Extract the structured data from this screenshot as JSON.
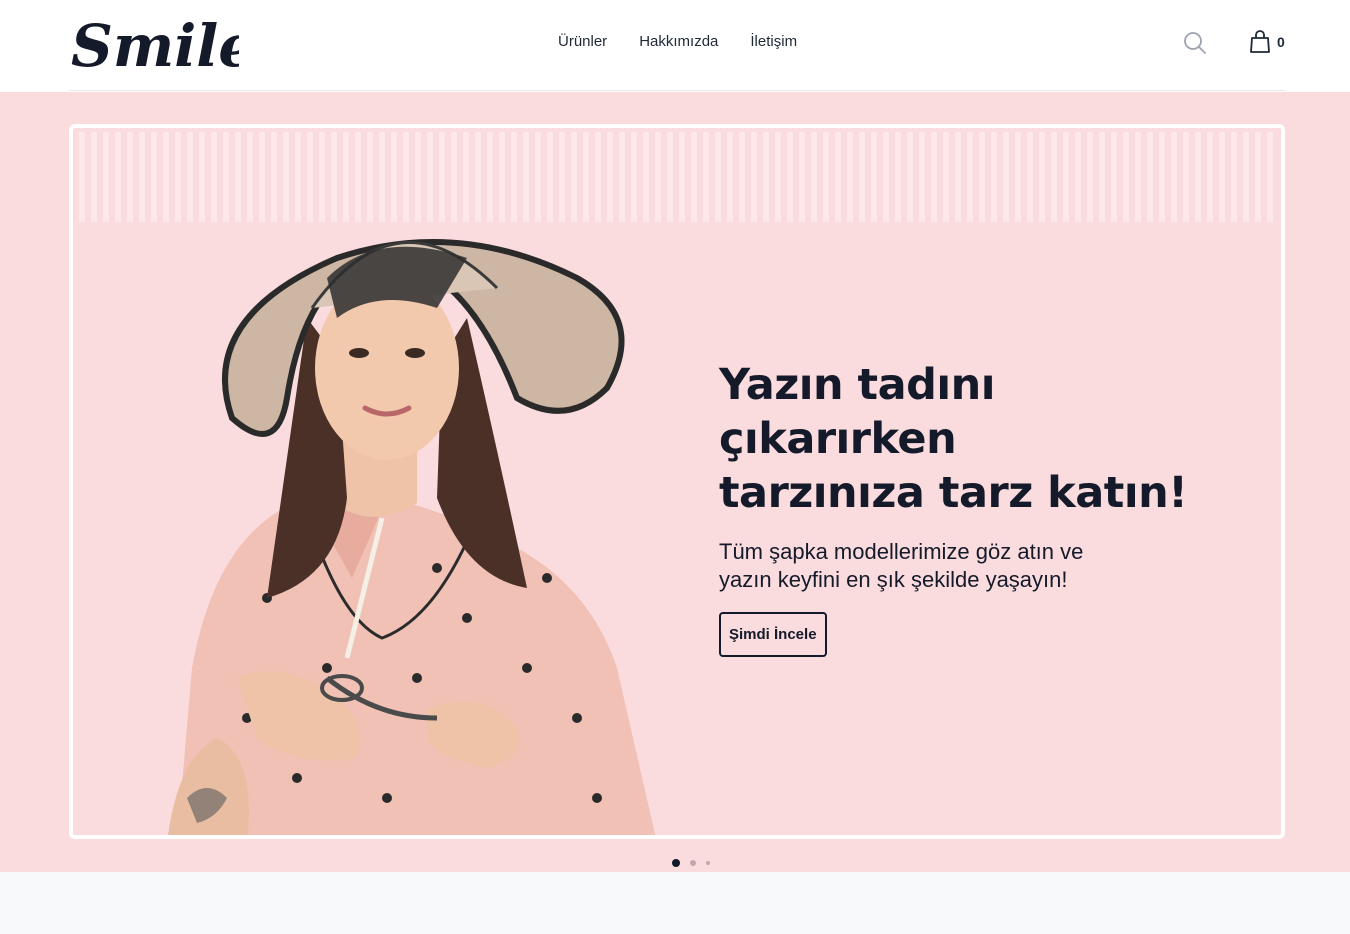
{
  "brand": {
    "logo_text": "Smile"
  },
  "nav": {
    "items": [
      "Ürünler",
      "Hakkımızda",
      "İletişim"
    ]
  },
  "cart": {
    "count": "0"
  },
  "hero": {
    "title_line1": "Yazın tadını çıkarırken",
    "title_line2": "tarzınıza tarz katın!",
    "subtitle_line1": "Tüm şapka modellerimize göz atın ve",
    "subtitle_line2": "yazın keyfini en şık şekilde yaşayın!",
    "cta_label": "Şimdi İncele"
  },
  "carousel": {
    "slide_count": 3,
    "active_index": 0
  },
  "icons": [
    "search-icon",
    "shopping-bag-icon"
  ],
  "colors": {
    "hero_bg": "#fadcdf",
    "text_dark": "#141a2a",
    "header_bg": "#ffffff",
    "page_bg": "#f8f9fb"
  }
}
